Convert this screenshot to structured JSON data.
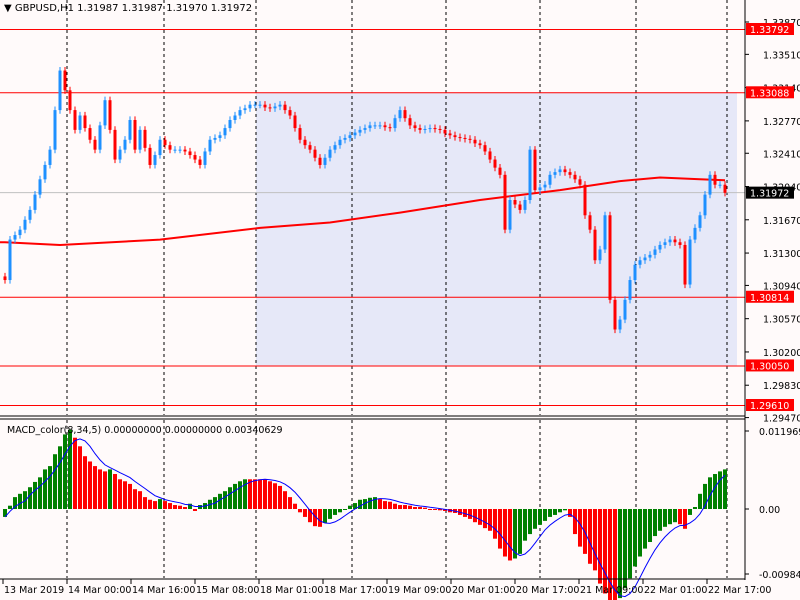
{
  "header": {
    "symbol": "GBPUSD,H1",
    "ohlc": "1.31987 1.31987 1.31970 1.31972",
    "menu_icon": "triangle-down-icon"
  },
  "macd_header": {
    "label": "MACD_color(8,34,5) 0.00000000 0.00000000 0.00340629"
  },
  "colors": {
    "bull": "#1e90ff",
    "bear": "#ff0000",
    "ma": "#ff0000",
    "level": "#ff0000",
    "zone": "#e6e8f8",
    "hist_up": "#008000",
    "hist_down": "#ff0000",
    "signal": "#0000ff",
    "bg": "#fffafa"
  },
  "chart_data": [
    {
      "type": "candlestick",
      "title": "GBPUSD,H1",
      "ylim": [
        1.2947,
        1.3387
      ],
      "y_ticks": [
        "1.33870",
        "1.33510",
        "1.33140",
        "1.32770",
        "1.32410",
        "1.32040",
        "1.31670",
        "1.31300",
        "1.30940",
        "1.30570",
        "1.30200",
        "1.29830",
        "1.29470"
      ],
      "current_price": "1.31972",
      "levels": [
        "1.33792",
        "1.33088",
        "1.30814",
        "1.30050",
        "1.29610"
      ],
      "zone": {
        "from_label": "18 Mar 01:00",
        "upper": 1.33088,
        "lower": 1.3005
      },
      "closes": [
        1.31,
        1.3145,
        1.315,
        1.3156,
        1.3167,
        1.3178,
        1.3195,
        1.3212,
        1.3228,
        1.3245,
        1.3289,
        1.3333,
        1.3311,
        1.3289,
        1.3267,
        1.3283,
        1.3269,
        1.3256,
        1.3245,
        1.3272,
        1.33,
        1.3267,
        1.3234,
        1.3245,
        1.3256,
        1.3278,
        1.3245,
        1.3267,
        1.3247,
        1.3228,
        1.3239,
        1.3256,
        1.325,
        1.3245,
        1.3245,
        1.3245,
        1.3243,
        1.3239,
        1.3234,
        1.3228,
        1.3243,
        1.3256,
        1.3258,
        1.3261,
        1.3269,
        1.3278,
        1.3283,
        1.3289,
        1.3291,
        1.3295,
        1.3295,
        1.3295,
        1.3292,
        1.3291,
        1.3293,
        1.3295,
        1.3289,
        1.3283,
        1.3269,
        1.3256,
        1.325,
        1.3245,
        1.3236,
        1.3228,
        1.3236,
        1.3245,
        1.325,
        1.3256,
        1.3258,
        1.3261,
        1.3264,
        1.3267,
        1.3269,
        1.3272,
        1.3272,
        1.3272,
        1.327,
        1.3269,
        1.328,
        1.3289,
        1.328,
        1.3272,
        1.3269,
        1.3267,
        1.3268,
        1.3269,
        1.3268,
        1.3267,
        1.3263,
        1.3261,
        1.3259,
        1.3258,
        1.3257,
        1.3256,
        1.3252,
        1.325,
        1.3243,
        1.3234,
        1.3225,
        1.3217,
        1.3156,
        1.3189,
        1.3184,
        1.3178,
        1.3189,
        1.3245,
        1.32,
        1.3203,
        1.3206,
        1.3217,
        1.322,
        1.3223,
        1.322,
        1.3217,
        1.3212,
        1.3206,
        1.3172,
        1.3156,
        1.3122,
        1.3134,
        1.3172,
        1.3078,
        1.3045,
        1.3056,
        1.3078,
        1.31,
        1.3117,
        1.3122,
        1.3125,
        1.3128,
        1.3134,
        1.3139,
        1.3142,
        1.3145,
        1.3142,
        1.3139,
        1.3095,
        1.3145,
        1.3158,
        1.3172,
        1.3195,
        1.3217,
        1.3206,
        1.3206,
        1.3197
      ],
      "moving_average": [
        [
          0,
          1.3142
        ],
        [
          11,
          1.3139
        ],
        [
          31,
          1.3145
        ],
        [
          51,
          1.3158
        ],
        [
          65,
          1.3164
        ],
        [
          79,
          1.3175
        ],
        [
          95,
          1.3189
        ],
        [
          111,
          1.32
        ],
        [
          123,
          1.321
        ],
        [
          131,
          1.3214
        ],
        [
          139,
          1.3212
        ],
        [
          144,
          1.3211
        ]
      ]
    },
    {
      "type": "bar",
      "title": "MACD_color(8,34,5)",
      "ylim": [
        -0.009845,
        0.0119691
      ],
      "y_ticks": [
        "0.0119691",
        "0.00",
        "-0.009845"
      ],
      "value_scale": 0.0001,
      "signal_period": 5,
      "histogram": [
        -12,
        5,
        18,
        23,
        27,
        33,
        41,
        48,
        60,
        65,
        83,
        95,
        113,
        120,
        108,
        95,
        80,
        72,
        65,
        60,
        57,
        60,
        53,
        45,
        42,
        38,
        30,
        27,
        18,
        14,
        12,
        15,
        12,
        9,
        6,
        5,
        3,
        8,
        -3,
        6,
        9,
        14,
        18,
        23,
        27,
        33,
        38,
        42,
        45,
        45,
        45,
        45,
        45,
        42,
        39,
        35,
        27,
        18,
        8,
        -5,
        -12,
        -20,
        -26,
        -27,
        -21,
        -15,
        -9,
        -5,
        0,
        5,
        9,
        14,
        15,
        17,
        18,
        15,
        12,
        11,
        8,
        6,
        6,
        5,
        3,
        3,
        2,
        0,
        0,
        -2,
        -3,
        -5,
        -6,
        -9,
        -12,
        -15,
        -20,
        -24,
        -29,
        -33,
        -45,
        -60,
        -72,
        -78,
        -75,
        -68,
        -48,
        -38,
        -30,
        -24,
        -18,
        -12,
        -9,
        -5,
        -2,
        -12,
        -38,
        -57,
        -68,
        -83,
        -93,
        -113,
        -128,
        -138,
        -143,
        -135,
        -120,
        -105,
        -87,
        -72,
        -60,
        -50,
        -41,
        -33,
        -27,
        -23,
        -20,
        -23,
        -30,
        -9,
        3,
        23,
        38,
        48,
        53,
        57,
        60
      ]
    }
  ],
  "x_axis": {
    "labels": [
      "13 Mar 2019",
      "14 Mar 00:00",
      "14 Mar 16:00",
      "15 Mar 08:00",
      "18 Mar 01:00",
      "18 Mar 17:00",
      "19 Mar 09:00",
      "20 Mar 01:00",
      "20 Mar 17:00",
      "21 Mar 09:00",
      "22 Mar 01:00",
      "22 Mar 17:00"
    ]
  }
}
